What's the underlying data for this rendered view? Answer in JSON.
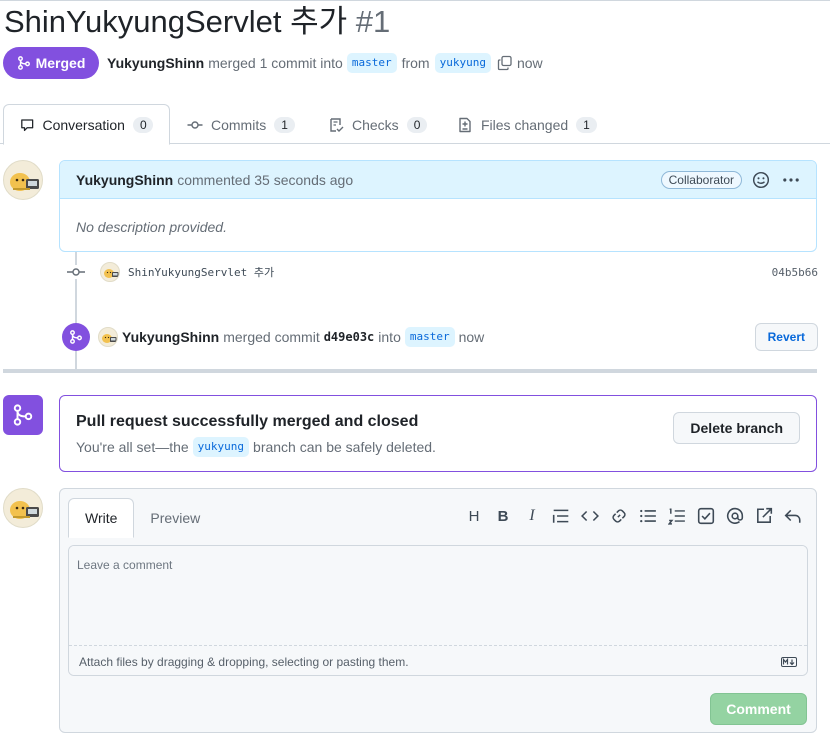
{
  "pr": {
    "title": "ShinYukyungServlet 추가",
    "number": "#1",
    "state": "Merged",
    "author": "YukyungShinn",
    "merge_text": "merged 1 commit into",
    "base": "master",
    "from_text": "from",
    "head": "yukyung",
    "time": "now"
  },
  "tabs": [
    {
      "label": "Conversation",
      "count": "0"
    },
    {
      "label": "Commits",
      "count": "1"
    },
    {
      "label": "Checks",
      "count": "0"
    },
    {
      "label": "Files changed",
      "count": "1"
    }
  ],
  "comment": {
    "author": "YukyungShinn",
    "action": "commented 35 seconds ago",
    "role": "Collaborator",
    "body": "No description provided."
  },
  "commit": {
    "message": "ShinYukyungServlet 추가",
    "sha": "04b5b66"
  },
  "merge_event": {
    "author": "YukyungShinn",
    "text": "merged commit",
    "sha": "d49e03c",
    "into": "into",
    "branch": "master",
    "time": "now",
    "revert_label": "Revert"
  },
  "merged_box": {
    "title": "Pull request successfully merged and closed",
    "sub_before": "You're all set—the",
    "branch": "yukyung",
    "sub_after": "branch can be safely deleted.",
    "delete_label": "Delete branch"
  },
  "editor": {
    "write_tab": "Write",
    "preview_tab": "Preview",
    "placeholder": "Leave a comment",
    "attach_text": "Attach files by dragging & dropping, selecting or pasting them.",
    "submit_label": "Comment",
    "toolbar_heading": "H",
    "toolbar_bold": "B",
    "toolbar_italic": "I"
  },
  "colors": {
    "merged": "#8250df",
    "link": "#0969da",
    "comment_header": "#ddf4ff",
    "submit_disabled": "#94d3a2"
  }
}
